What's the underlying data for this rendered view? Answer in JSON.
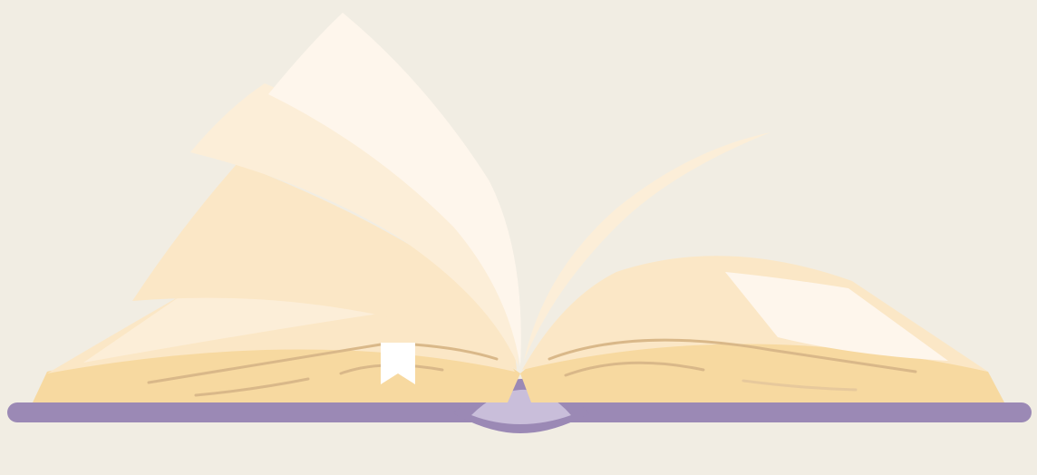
{
  "scene": {
    "subject": "open-book-icon",
    "colors": {
      "background": "#F1EDE3",
      "cover": "#9B89B5",
      "cover_light": "#C9BEDA",
      "page_base": "#F7D9A0",
      "page_mid": "#FBE7C6",
      "page_light": "#FCEED8",
      "page_lightest": "#FEF6EC",
      "page_line": "#D9B889",
      "bookmark": "#FFFFFF"
    },
    "icons": [
      "open-book-icon",
      "bookmark-icon"
    ]
  }
}
